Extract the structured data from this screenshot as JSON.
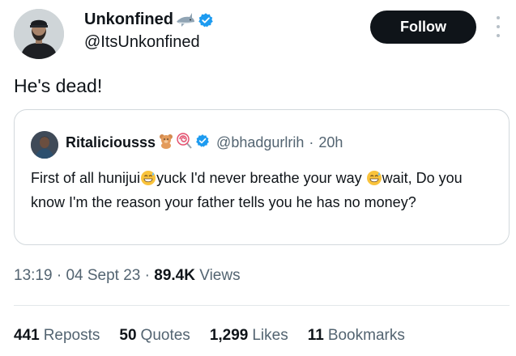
{
  "author": {
    "display_name": "Unkonfined",
    "handle": "@ItsUnkonfined",
    "badge_icon": "shark-emoji-icon",
    "verified_icon": "verified-badge-icon"
  },
  "follow_button": {
    "label": "Follow"
  },
  "more_icon": "more-vertical-icon",
  "tweet": {
    "text": "He's dead!"
  },
  "quoted": {
    "display_name": "Ritaliciousss",
    "name_icons": [
      "teddy-bear-emoji-icon",
      "lollipop-emoji-icon"
    ],
    "handle": "@bhadgurlrih",
    "separator": "·",
    "time": "20h",
    "text_part1": "First of all hunijui",
    "text_part2": "yuck I'd never breathe your way ",
    "text_part3": "wait, Do you know I'm the reason your father tells you he has no money?",
    "inline_emoji": "grinning-sweat-emoji-icon"
  },
  "meta": {
    "time": "13:19",
    "sep": "·",
    "date": "04 Sept 23",
    "views_count": "89.4K",
    "views_label": "Views"
  },
  "stats": [
    {
      "num": "441",
      "label": "Reposts"
    },
    {
      "num": "50",
      "label": "Quotes"
    },
    {
      "num": "1,299",
      "label": "Likes"
    },
    {
      "num": "11",
      "label": "Bookmarks"
    }
  ],
  "colors": {
    "text": "#0f1419",
    "secondary": "#536471",
    "verified": "#1d9bf0",
    "button_bg": "#0f1419",
    "border": "#d2d8dc"
  }
}
